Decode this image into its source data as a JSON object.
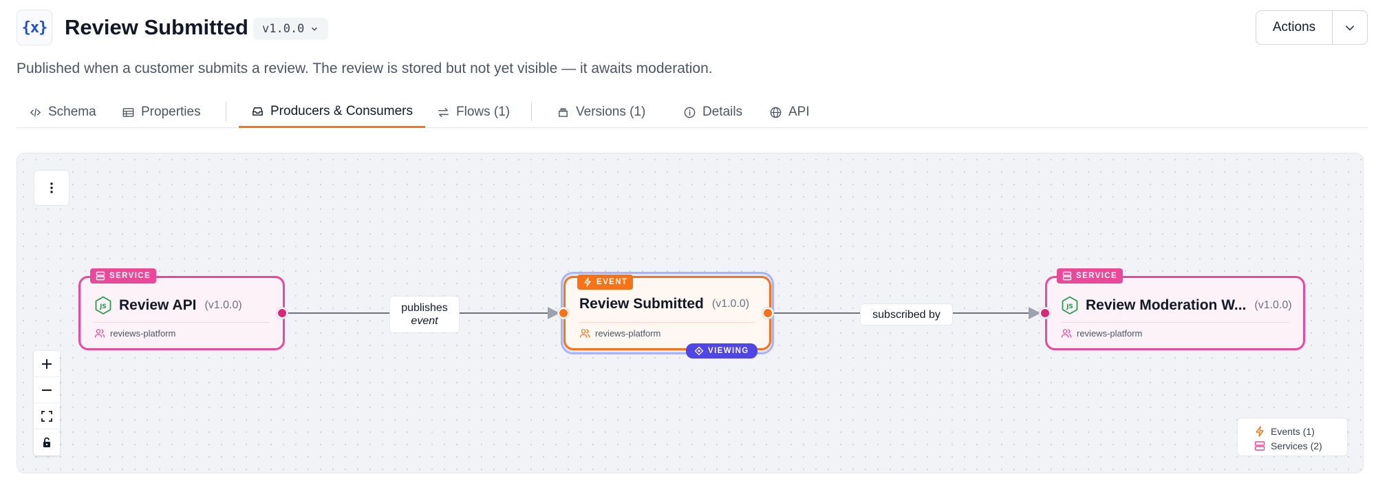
{
  "header": {
    "logo_text": "{x}",
    "title": "Review Submitted",
    "version": "v1.0.0",
    "description": "Published when a customer submits a review. The review is stored but not yet visible — it awaits moderation.",
    "actions_label": "Actions"
  },
  "tabs": [
    {
      "label": "Schema",
      "icon": "code-icon"
    },
    {
      "label": "Properties",
      "icon": "table-icon"
    },
    {
      "label": "Producers & Consumers",
      "icon": "inbox-icon",
      "active": true
    },
    {
      "label": "Flows (1)",
      "icon": "arrows-icon"
    },
    {
      "label": "Versions (1)",
      "icon": "layers-icon"
    },
    {
      "label": "Details",
      "icon": "info-icon"
    },
    {
      "label": "API",
      "icon": "globe-icon"
    }
  ],
  "graph": {
    "nodes": {
      "producer": {
        "badge": "SERVICE",
        "name": "Review API",
        "version": "(v1.0.0)",
        "owner": "reviews-platform"
      },
      "event": {
        "badge": "EVENT",
        "name": "Review Submitted",
        "version": "(v1.0.0)",
        "owner": "reviews-platform",
        "status": "VIEWING"
      },
      "consumer": {
        "badge": "SERVICE",
        "name": "Review Moderation W...",
        "version": "(v1.0.0)",
        "owner": "reviews-platform"
      }
    },
    "edges": {
      "publishes_line1": "publishes",
      "publishes_line2": "event",
      "subscribed": "subscribed by"
    }
  },
  "legend": {
    "events": "Events (1)",
    "services": "Services (2)"
  },
  "colors": {
    "service": "#ec4899",
    "event": "#f97316",
    "viewing": "#4f46e5",
    "tab_active": "#f97316"
  }
}
